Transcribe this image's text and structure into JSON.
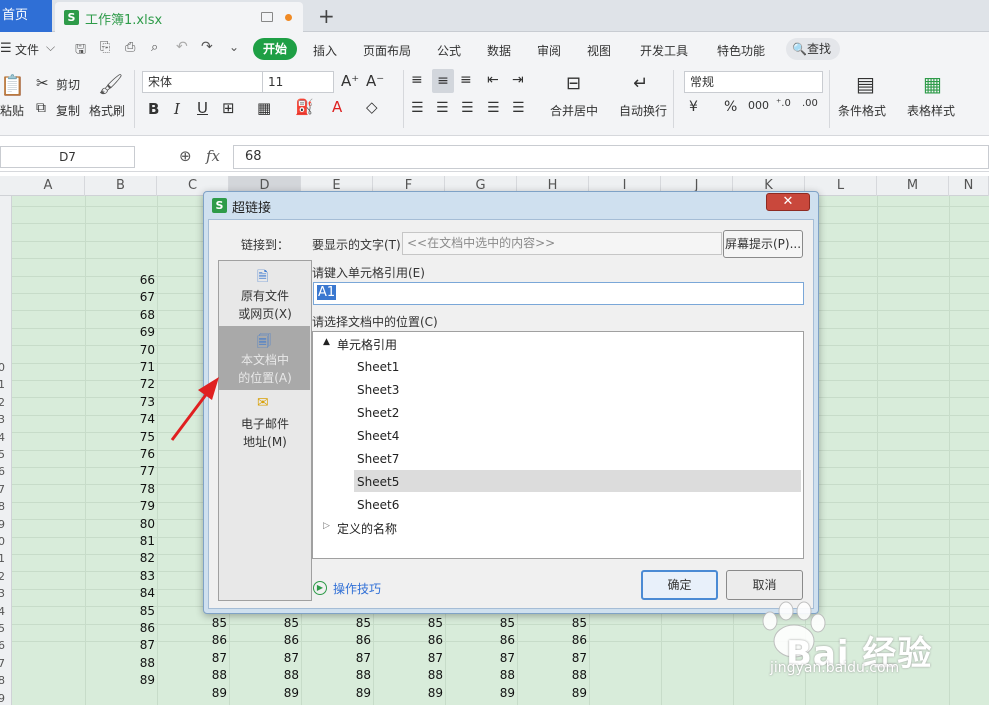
{
  "tabs": {
    "home": "首页",
    "doc": "工作簿1.xlsx",
    "new_tab": "+"
  },
  "menu": {
    "file": "文件",
    "items": [
      "开始",
      "插入",
      "页面布局",
      "公式",
      "数据",
      "审阅",
      "视图",
      "开发工具",
      "特色功能"
    ],
    "search": "查找"
  },
  "ribbon": {
    "paste": "粘贴",
    "cut": "剪切",
    "copy": "复制",
    "format_painter": "格式刷",
    "font_name": "宋体",
    "font_size": "11",
    "merge_center": "合并居中",
    "wrap_text": "自动换行",
    "number_format": "常规",
    "conditional_format": "条件格式",
    "table_style": "表格样式"
  },
  "formula_bar": {
    "cell_ref": "D7",
    "fx": "fx",
    "value": "68"
  },
  "columns": [
    "A",
    "B",
    "C",
    "D",
    "E",
    "F",
    "G",
    "H",
    "I",
    "J",
    "K",
    "L",
    "M",
    "N"
  ],
  "row_headers": [
    "0",
    "1",
    "2",
    "3",
    "4",
    "5",
    "6",
    "7",
    "8",
    "9",
    "0",
    "1",
    "2",
    "3",
    "4",
    "5",
    "6",
    "7",
    "8",
    "9"
  ],
  "col_b_values": [
    "66",
    "67",
    "68",
    "69",
    "70",
    "71",
    "72",
    "73",
    "74",
    "75",
    "76",
    "77",
    "78",
    "79",
    "80",
    "81",
    "82",
    "83",
    "84",
    "85",
    "86",
    "87",
    "88",
    "89"
  ],
  "bottom_rows": [
    [
      "85",
      "85",
      "85",
      "85",
      "85",
      "85"
    ],
    [
      "86",
      "86",
      "86",
      "86",
      "86",
      "86"
    ],
    [
      "87",
      "87",
      "87",
      "87",
      "87",
      "87"
    ],
    [
      "88",
      "88",
      "88",
      "88",
      "88",
      "88"
    ],
    [
      "89",
      "89",
      "89",
      "89",
      "89",
      "89"
    ]
  ],
  "dialog": {
    "title": "超链接",
    "close": "✕",
    "link_to_label": "链接到：",
    "display_text_label": "要显示的文字(T):",
    "display_text_value": "<<在文档中选中的内容>>",
    "screen_tip_button": "屏幕提示(P)...",
    "link_types": [
      {
        "line1": "原有文件",
        "line2": "或网页(X)"
      },
      {
        "line1": "本文档中",
        "line2": "的位置(A)"
      },
      {
        "line1": "电子邮件",
        "line2": "地址(M)"
      }
    ],
    "cell_ref_label": "请键入单元格引用(E)",
    "cell_ref_value": "A1",
    "location_label": "请选择文档中的位置(C)",
    "tree": {
      "cell_refs": "单元格引用",
      "sheets": [
        "Sheet1",
        "Sheet3",
        "Sheet2",
        "Sheet4",
        "Sheet7",
        "Sheet5",
        "Sheet6"
      ],
      "defined_names": "定义的名称"
    },
    "tips": "操作技巧",
    "ok": "确定",
    "cancel": "取消"
  },
  "watermark": {
    "text": "Bai 经验",
    "url": "jingyan.baidu.com"
  },
  "colors": {
    "accent": "#2f6fd6",
    "start_tab": "#1e9f45",
    "sheet_bg": "#d8ecda",
    "arrow": "#e02020"
  }
}
